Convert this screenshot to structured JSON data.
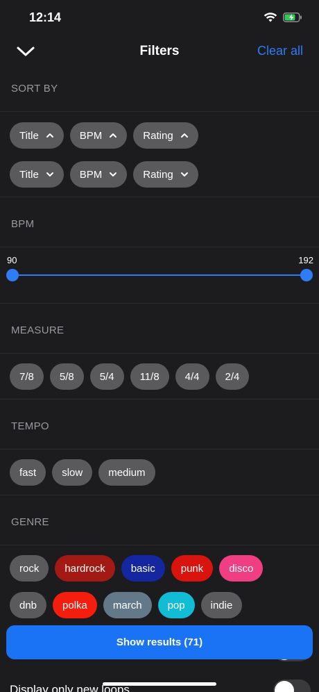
{
  "status": {
    "time": "12:14"
  },
  "nav": {
    "title": "Filters",
    "clear_label": "Clear all"
  },
  "sections": {
    "sort_by": "SORT BY",
    "bpm": "BPM",
    "measure": "MEASURE",
    "tempo": "TEMPO",
    "genre": "GENRE"
  },
  "sort_asc": [
    {
      "label": "Title",
      "dir": "up"
    },
    {
      "label": "BPM",
      "dir": "up"
    },
    {
      "label": "Rating",
      "dir": "up"
    }
  ],
  "sort_desc": [
    {
      "label": "Title",
      "dir": "down"
    },
    {
      "label": "BPM",
      "dir": "down"
    },
    {
      "label": "Rating",
      "dir": "down"
    }
  ],
  "bpm_range": {
    "min_label": "90",
    "max_label": "192",
    "min": 90,
    "max": 192
  },
  "measures": [
    "7/8",
    "5/8",
    "5/4",
    "11/8",
    "4/4",
    "2/4"
  ],
  "tempos": [
    "fast",
    "slow",
    "medium"
  ],
  "genres_row1": [
    {
      "label": "rock",
      "color": "#5a5a5c"
    },
    {
      "label": "hardrock",
      "color": "#a31a14"
    },
    {
      "label": "basic",
      "color": "#1426a0"
    },
    {
      "label": "punk",
      "color": "#d9140f"
    },
    {
      "label": "disco",
      "color": "#ef3f82"
    }
  ],
  "genres_row2": [
    {
      "label": "dnb",
      "color": "#5a5a5c"
    },
    {
      "label": "polka",
      "color": "#f51d0e"
    },
    {
      "label": "march",
      "color": "#63798a"
    },
    {
      "label": "pop",
      "color": "#12bcd4"
    },
    {
      "label": "indie",
      "color": "#5a5a5c"
    }
  ],
  "show_results_label": "Show results (71)",
  "display_new_loops_label": "Display only new loops",
  "colors": {
    "accent": "#2f7cf6",
    "background": "#1c1c1e",
    "chip": "#5a5a5c"
  }
}
